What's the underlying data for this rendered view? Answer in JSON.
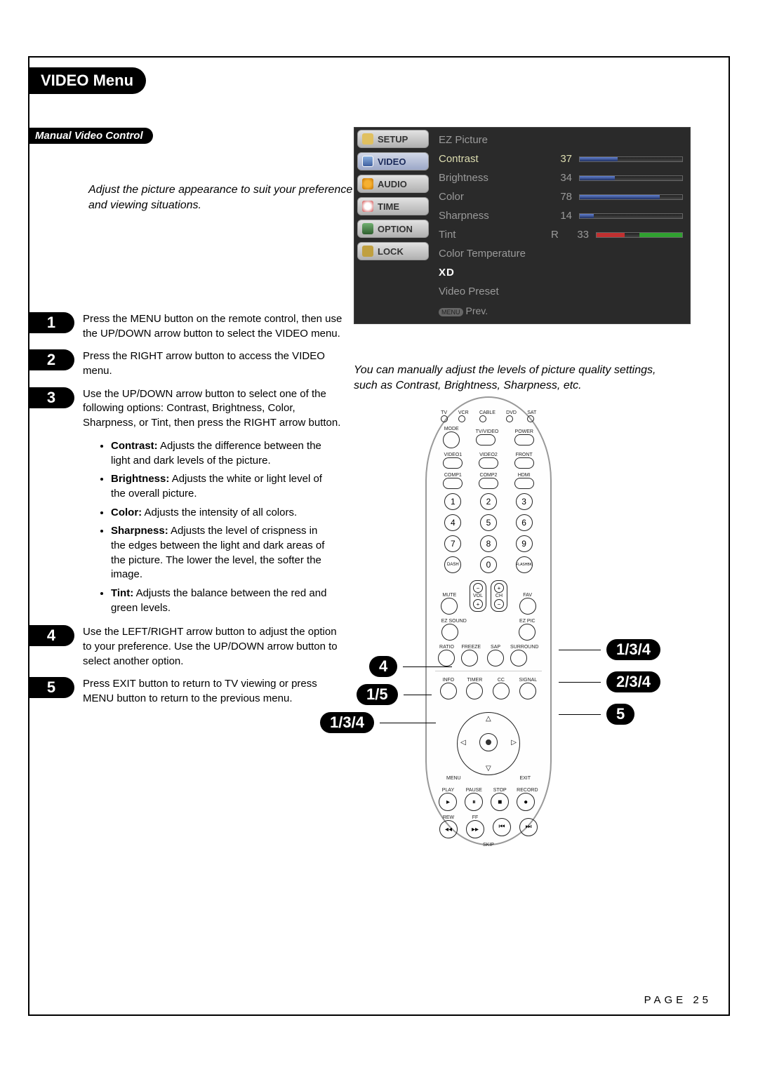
{
  "header": {
    "title": "VIDEO Menu"
  },
  "section": {
    "title": "Manual Video Control"
  },
  "intro": "Adjust the picture appearance to suit your preference and viewing situations.",
  "caption": "You can manually adjust the levels of picture quality settings, such as Contrast, Brightness, Sharpness, etc.",
  "osd": {
    "tabs": [
      "SETUP",
      "VIDEO",
      "AUDIO",
      "TIME",
      "OPTION",
      "LOCK"
    ],
    "active_tab": "VIDEO",
    "items": {
      "ez_picture": "EZ Picture",
      "contrast_label": "Contrast",
      "contrast_val": "37",
      "brightness_label": "Brightness",
      "brightness_val": "34",
      "color_label": "Color",
      "color_val": "78",
      "sharpness_label": "Sharpness",
      "sharpness_val": "14",
      "tint_label": "Tint",
      "tint_prefix": "R",
      "tint_val": "33",
      "color_temp": "Color Temperature",
      "xd": "XD",
      "video_preset": "Video Preset",
      "prev_tag": "MENU",
      "prev": "Prev."
    }
  },
  "steps": {
    "s1": "Press the MENU button on the remote control, then use the UP/DOWN arrow button to select the VIDEO menu.",
    "s2": "Press the RIGHT arrow button to access the VIDEO menu.",
    "s3": "Use the UP/DOWN arrow button to select one of the following options: Contrast, Brightness, Color, Sharpness, or Tint, then press the RIGHT arrow button.",
    "s4": "Use the LEFT/RIGHT arrow button to adjust the option to your preference. Use the UP/DOWN arrow button to select another option.",
    "s5": "Press EXIT button to return to TV viewing or press MENU button to return to the previous menu."
  },
  "bullets": {
    "b1l": "Contrast:",
    "b1t": "Adjusts the difference between the light and dark levels of the picture.",
    "b2l": "Brightness:",
    "b2t": "Adjusts the white or light level of the overall picture.",
    "b3l": "Color:",
    "b3t": "Adjusts the intensity of all colors.",
    "b4l": "Sharpness:",
    "b4t": "Adjusts the level of crispness in the edges between the light and dark areas of the picture. The lower the level, the softer the image.",
    "b5l": "Tint:",
    "b5t": "Adjusts the balance between the red and green levels."
  },
  "nums": {
    "n1": "1",
    "n2": "2",
    "n3": "3",
    "n4": "4",
    "n5": "5"
  },
  "callouts": {
    "c1": "1/3/4",
    "c2": "2/3/4",
    "c3": "5",
    "c4": "1/5",
    "c5": "4",
    "c6": "1/3/4"
  },
  "remote": {
    "top": {
      "tv": "TV",
      "vcr": "VCR",
      "cable": "CABLE",
      "dvd": "DVD",
      "sat": "SAT"
    },
    "row2": {
      "mode": "MODE",
      "tvvideo": "TV/VIDEO",
      "power": "POWER"
    },
    "row3": {
      "video1": "VIDEO1",
      "video2": "VIDEO2",
      "front": "FRONT"
    },
    "row4": {
      "comp1": "COMP1",
      "comp2": "COMP2",
      "hdmi": "HDMI"
    },
    "dash": "DASH",
    "zero": "0",
    "flashbk": "FLASHBK",
    "mute": "MUTE",
    "fav": "FAV",
    "ezsound": "EZ SOUND",
    "ezpic": "EZ PIC",
    "vol": "VOL",
    "ch": "CH",
    "ratio": "RATIO",
    "freeze": "FREEZE",
    "sap": "SAP",
    "surround": "SURROUND",
    "info": "INFO",
    "timer": "TIMER",
    "cc": "CC",
    "signal": "SIGNAL",
    "menu": "MENU",
    "exit": "EXIT",
    "play": "PLAY",
    "pause": "PAUSE",
    "stop": "STOP",
    "record": "RECORD",
    "rew": "REW",
    "ff": "FF",
    "skip": "SKIP"
  },
  "footer": {
    "page_label": "PAGE 25"
  }
}
